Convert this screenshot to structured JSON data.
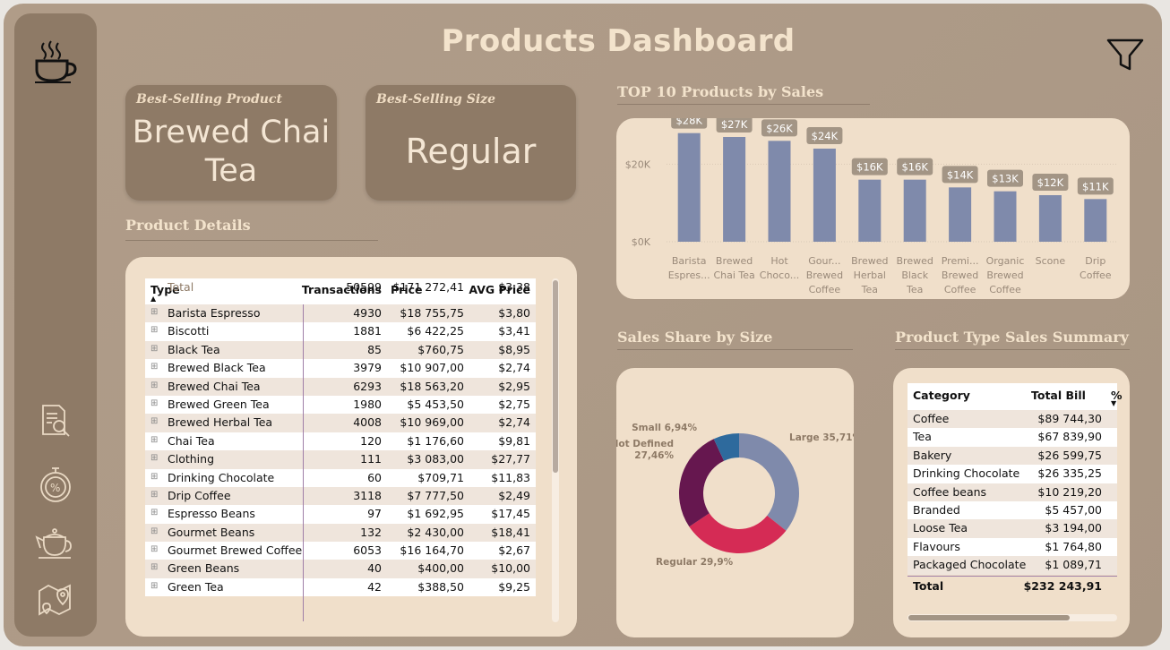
{
  "header": {
    "title": "Products Dashboard"
  },
  "sidebar": {
    "items": [
      {
        "icon": "coffee-cup-icon"
      },
      {
        "icon": "report-search-icon"
      },
      {
        "icon": "discount-stopwatch-icon"
      },
      {
        "icon": "teapot-icon"
      },
      {
        "icon": "map-location-icon"
      }
    ]
  },
  "kpis": {
    "best_product_label": "Best-Selling Product",
    "best_product_line1": "Brewed Chai",
    "best_product_line2": "Tea",
    "best_size_label": "Best-Selling Size",
    "best_size_value": "Regular"
  },
  "product_details": {
    "title": "Product Details",
    "columns": [
      "Type",
      "Transactions",
      "Price",
      "AVG Price"
    ],
    "rows": [
      [
        "Barista Espresso",
        "4930",
        "$18 755,75",
        "$3,80"
      ],
      [
        "Biscotti",
        "1881",
        "$6 422,25",
        "$3,41"
      ],
      [
        "Black Tea",
        "85",
        "$760,75",
        "$8,95"
      ],
      [
        "Brewed Black Tea",
        "3979",
        "$10 907,00",
        "$2,74"
      ],
      [
        "Brewed Chai Tea",
        "6293",
        "$18 563,20",
        "$2,95"
      ],
      [
        "Brewed Green Tea",
        "1980",
        "$5 453,50",
        "$2,75"
      ],
      [
        "Brewed Herbal Tea",
        "4008",
        "$10 969,00",
        "$2,74"
      ],
      [
        "Chai Tea",
        "120",
        "$1 176,60",
        "$9,81"
      ],
      [
        "Clothing",
        "111",
        "$3 083,00",
        "$27,77"
      ],
      [
        "Drinking Chocolate",
        "60",
        "$709,71",
        "$11,83"
      ],
      [
        "Drip Coffee",
        "3118",
        "$7 777,50",
        "$2,49"
      ],
      [
        "Espresso Beans",
        "97",
        "$1 692,95",
        "$17,45"
      ],
      [
        "Gourmet Beans",
        "132",
        "$2 430,00",
        "$18,41"
      ],
      [
        "Gourmet Brewed Coffee",
        "6053",
        "$16 164,70",
        "$2,67"
      ],
      [
        "Green Beans",
        "40",
        "$400,00",
        "$10,00"
      ],
      [
        "Green Tea",
        "42",
        "$388,50",
        "$9,25"
      ]
    ],
    "total": {
      "label": "Total",
      "transactions": "50599",
      "price": "$171 272,41",
      "avg": "$3,38"
    }
  },
  "top10": {
    "title": "TOP 10 Products by Sales"
  },
  "size_share": {
    "title": "Sales Share by Size"
  },
  "type_summary": {
    "title": "Product Type Sales Summary",
    "columns": [
      "Category",
      "Total Bill",
      "%"
    ],
    "rows": [
      [
        "Coffee",
        "$89 744,30"
      ],
      [
        "Tea",
        "$67 839,90"
      ],
      [
        "Bakery",
        "$26 599,75"
      ],
      [
        "Drinking Chocolate",
        "$26 335,25"
      ],
      [
        "Coffee beans",
        "$10 219,20"
      ],
      [
        "Branded",
        "$5 457,00"
      ],
      [
        "Loose Tea",
        "$3 194,00"
      ],
      [
        "Flavours",
        "$1 764,80"
      ],
      [
        "Packaged Chocolate",
        "$1 089,71"
      ]
    ],
    "total": {
      "label": "Total",
      "value": "$232 243,91"
    }
  },
  "chart_data": [
    {
      "type": "bar",
      "title": "TOP 10 Products by Sales",
      "categories": [
        [
          "Barista",
          "Espres..."
        ],
        [
          "Brewed",
          "Chai Tea"
        ],
        [
          "Hot",
          "Choco..."
        ],
        [
          "Gour...",
          "Brewed",
          "Coffee"
        ],
        [
          "Brewed",
          "Herbal",
          "Tea"
        ],
        [
          "Brewed",
          "Black",
          "Tea"
        ],
        [
          "Premi...",
          "Brewed",
          "Coffee"
        ],
        [
          "Organic",
          "Brewed",
          "Coffee"
        ],
        [
          "Scone"
        ],
        [
          "Drip",
          "Coffee"
        ]
      ],
      "values": [
        28000,
        27000,
        26000,
        24000,
        16000,
        16000,
        14000,
        13000,
        12000,
        11000
      ],
      "data_labels": [
        "$28K",
        "$27K",
        "$26K",
        "$24K",
        "$16K",
        "$16K",
        "$14K",
        "$13K",
        "$12K",
        "$11K"
      ],
      "yticks": [
        {
          "value": 0,
          "label": "$0K"
        },
        {
          "value": 20000,
          "label": "$20K"
        }
      ],
      "ylim": [
        0,
        30000
      ],
      "bar_color": "#7f8aab",
      "grid": true
    },
    {
      "type": "pie",
      "title": "Sales Share by Size",
      "slices": [
        {
          "name": "Large",
          "value": 35.71,
          "label": "Large 35,71%",
          "color": "#7f8aab"
        },
        {
          "name": "Regular",
          "value": 29.9,
          "label": "Regular 29,9%",
          "color": "#d52b55"
        },
        {
          "name": "Not Defined",
          "value": 27.46,
          "label": "Not Defined\n27,46%",
          "color": "#66174f"
        },
        {
          "name": "Small",
          "value": 6.94,
          "label": "Small 6,94%",
          "color": "#2e6a9d"
        }
      ]
    }
  ]
}
